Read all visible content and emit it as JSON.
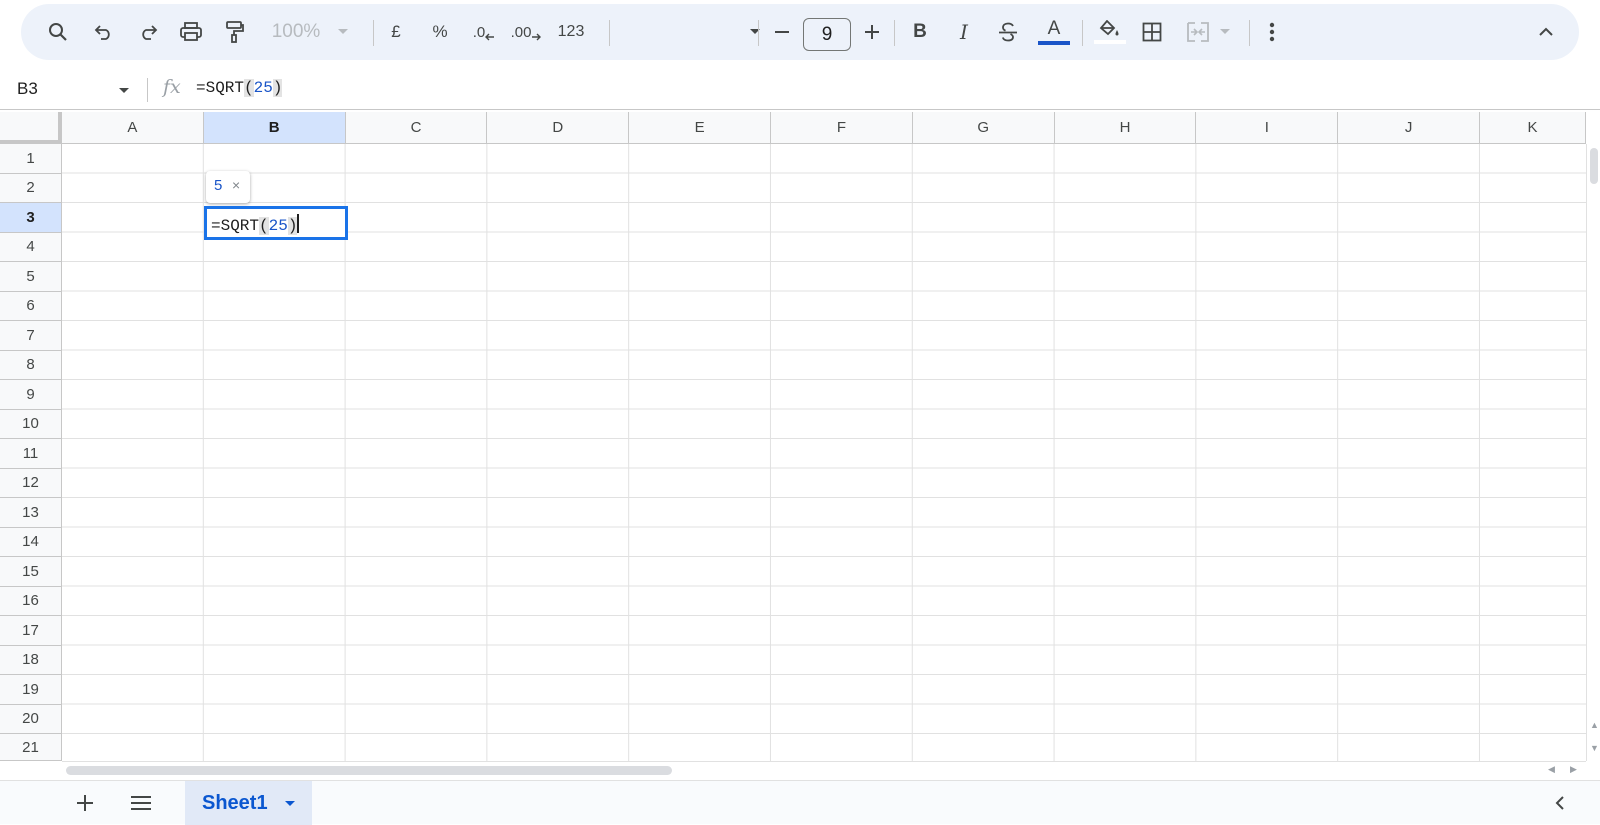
{
  "toolbar": {
    "zoom": "100%",
    "currency": "£",
    "percent": "%",
    "decrease_decimals": ".0",
    "increase_decimals": ".00",
    "more_formats": "123",
    "font_size": "9",
    "icons": [
      "search-icon",
      "undo-icon",
      "redo-icon",
      "print-icon",
      "paint-format-icon",
      "chevron-down-icon",
      "minus-icon",
      "plus-icon",
      "bold-icon",
      "italic-icon",
      "strikethrough-icon",
      "text-color-icon",
      "fill-color-icon",
      "borders-icon",
      "merge-cells-icon",
      "more-vert-icon",
      "chevron-up-icon"
    ],
    "text_color": "#1a55c8"
  },
  "formula_bar": {
    "name_box": "B3",
    "fx": "fx",
    "formula_prefix": "=SQRT",
    "formula_open": "(",
    "formula_arg": "25",
    "formula_close": ")"
  },
  "grid": {
    "columns": [
      "A",
      "B",
      "C",
      "D",
      "E",
      "F",
      "G",
      "H",
      "I",
      "J",
      "K"
    ],
    "rows": [
      "1",
      "2",
      "3",
      "4",
      "5",
      "6",
      "7",
      "8",
      "9",
      "10",
      "11",
      "12",
      "13",
      "14",
      "15",
      "16",
      "17",
      "18",
      "19",
      "20",
      "21"
    ],
    "selected_column": "B",
    "selected_row": "3"
  },
  "editor": {
    "prefix": "=SQRT",
    "open": "(",
    "arg": "25",
    "close": ")"
  },
  "preview_tooltip": {
    "value": "5",
    "close": "×"
  },
  "sheets": {
    "active": "Sheet1"
  },
  "colors": {
    "accent": "#1a73e8",
    "selected_header": "#d3e3fd",
    "toolbar_bg": "#edf2fa"
  }
}
